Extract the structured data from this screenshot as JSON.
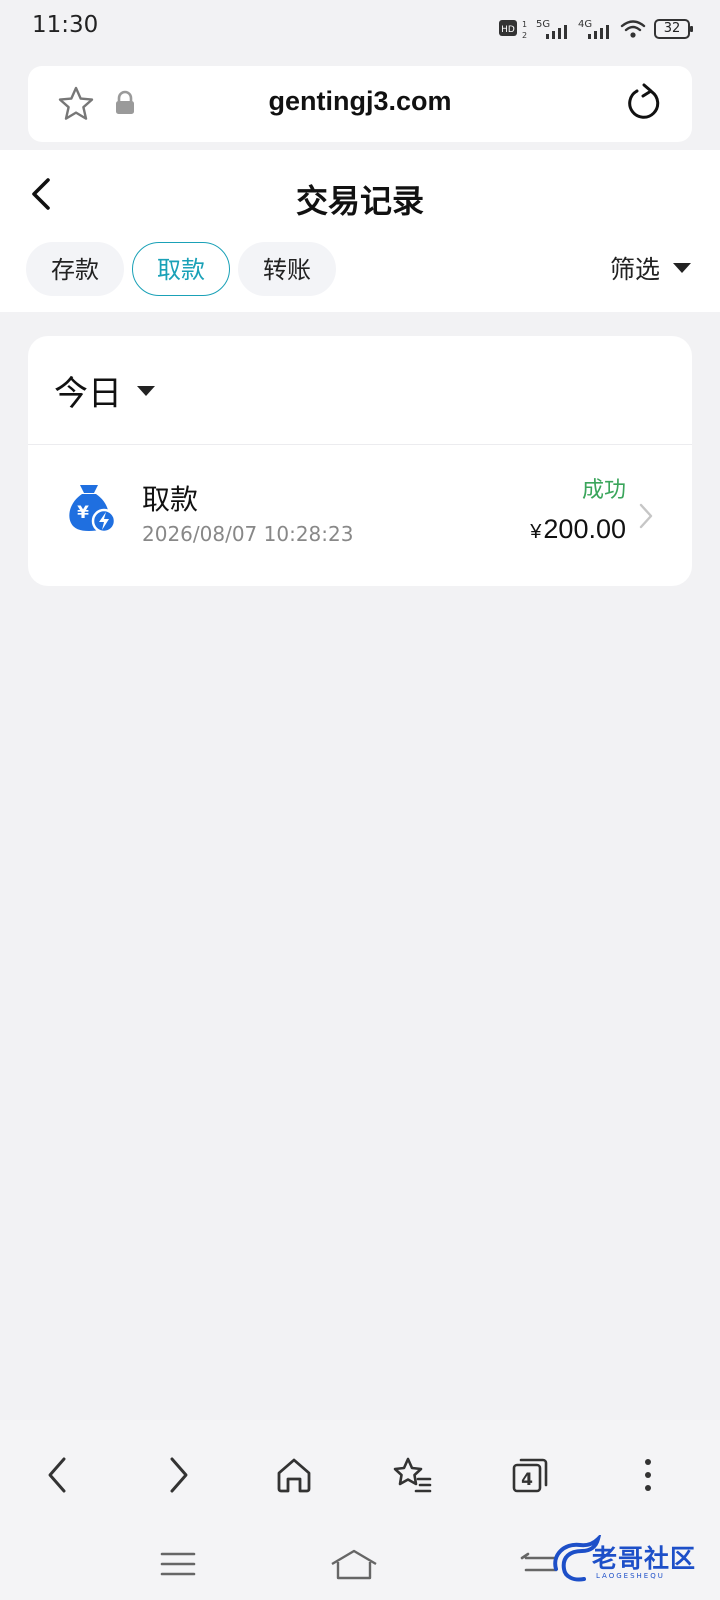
{
  "status_bar": {
    "time": "11:30",
    "signal_1": "5G",
    "signal_2": "4G",
    "battery": "32"
  },
  "browser": {
    "url": "gentingj3.com"
  },
  "header": {
    "title": "交易记录",
    "tabs": [
      {
        "label": "存款",
        "active": false
      },
      {
        "label": "取款",
        "active": true
      },
      {
        "label": "转账",
        "active": false
      }
    ],
    "filter_label": "筛选"
  },
  "records": {
    "period_label": "今日",
    "items": [
      {
        "name": "取款",
        "datetime": "2026/08/07 10:28:23",
        "status": "成功",
        "currency": "¥",
        "amount": "200.00"
      }
    ]
  },
  "browser_nav": {
    "tab_count": "4"
  },
  "watermark": {
    "text": "老哥社区",
    "subtext": "LAOGESHEQU"
  },
  "colors": {
    "accent": "#1aa1b7",
    "success": "#3aa55b",
    "icon_blue": "#1f6fe0"
  }
}
